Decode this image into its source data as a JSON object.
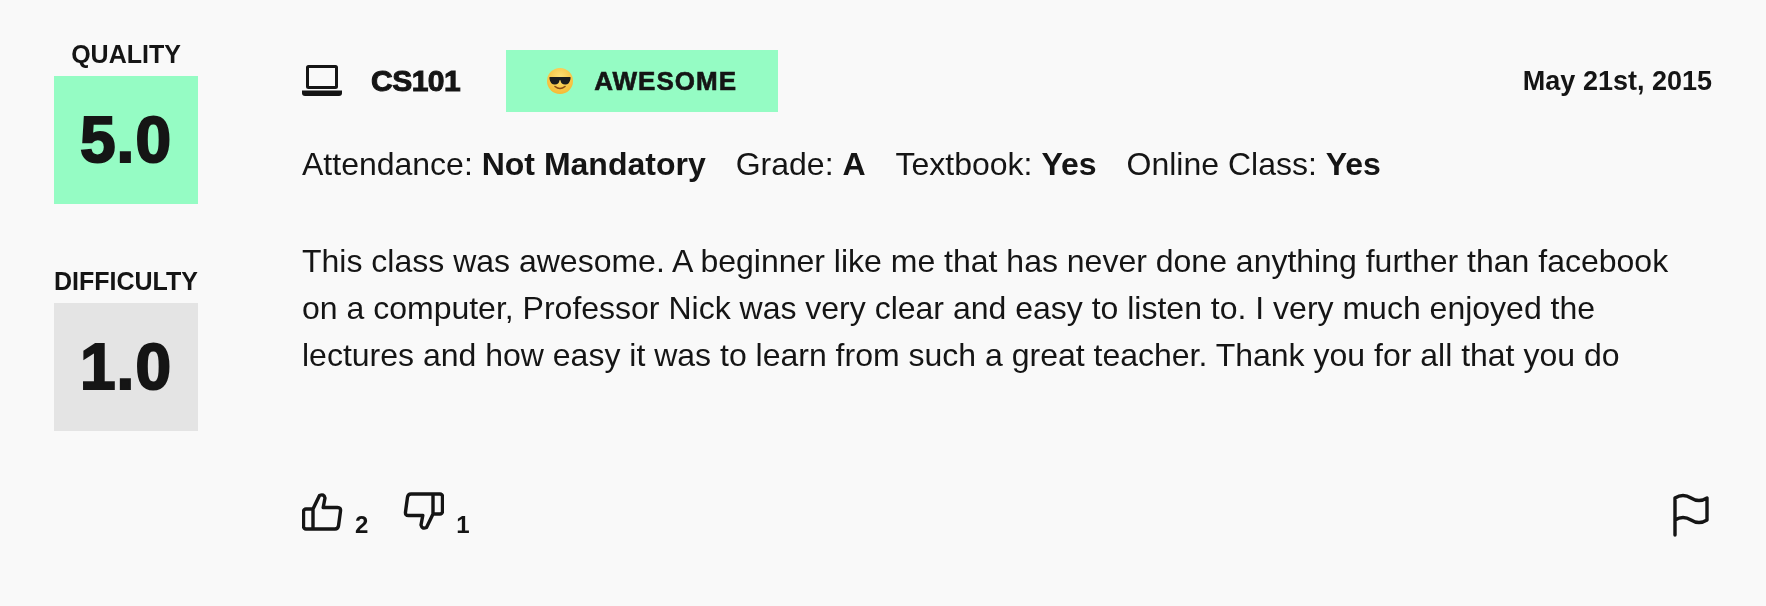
{
  "ratings": [
    {
      "label": "QUALITY",
      "value": "5.0",
      "color": "#95fcc4"
    },
    {
      "label": "DIFFICULTY",
      "value": "1.0",
      "color": "#e4e4e4"
    }
  ],
  "review": {
    "course": "CS101",
    "tag": {
      "label": "AWESOME"
    },
    "date": "May 21st, 2015",
    "attributes": [
      {
        "label": "Attendance:",
        "value": "Not Mandatory"
      },
      {
        "label": "Grade:",
        "value": "A"
      },
      {
        "label": "Textbook:",
        "value": "Yes"
      },
      {
        "label": "Online Class:",
        "value": "Yes"
      }
    ],
    "comment": "This class was awesome. A beginner like me that has never done anything further than facebook on a computer, Professor Nick was very clear and easy to listen to. I very much enjoyed the lectures and how easy it was to learn from such a great teacher. Thank you for all that you do",
    "votes": [
      {
        "kind": "up",
        "count": "2"
      },
      {
        "kind": "down",
        "count": "1"
      }
    ]
  }
}
